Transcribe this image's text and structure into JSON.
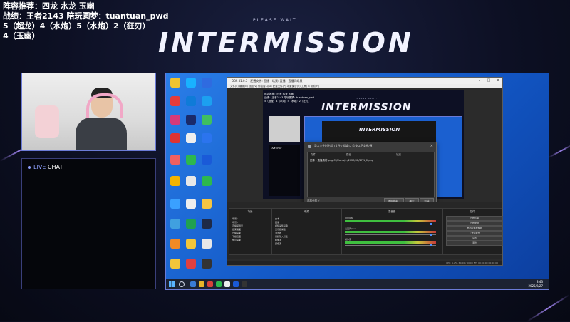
{
  "overlay": {
    "line1": "阵容推荐：四龙 水龙 玉幽",
    "line2": "战绩：王者2143 陪玩圆梦：tuantuan_pwd",
    "line3": "5（超龙）4（水炮）5（水炮）2（狂刃）",
    "line4": "4（玉幽）"
  },
  "title": {
    "subtitle": "PLEASE WAIT...",
    "main": "INTERMISSION"
  },
  "chat": {
    "live_word": "LIVE",
    "chat_word": "CHAT"
  },
  "obs": {
    "window_title": "OBS 31.0.3 - 配置文件: 直播 - 场景: 直播 - 直播间场景",
    "menu": "文件(F)  编辑(E)  视图(V)  停靠窗口(D)  配置文件(P)  场景集合(S)  工具(T)  帮助(H)",
    "preview_title": "INTERMISSION",
    "preview_subtitle": "PLEASE WAIT...",
    "nested_title": "INTERMISSION",
    "preview_chat": "LIVE CHAT",
    "dialog": {
      "title": "导入文件时出错 (文件 / 错误)，检查以下文件/源：",
      "col_file": "文件",
      "col_path": "路径",
      "col_status": "状态",
      "row": "图像 - 直播素材.png  C:/Users/.../2025/02/27/1_2.png",
      "left_btn": "选择全部  ✓",
      "btn_apply": "重新搜索...",
      "btn_ok": "确定",
      "btn_cancel": "取消"
    },
    "docks": {
      "scenes": "场景",
      "sources": "来源",
      "mixer": "混音器",
      "transitions": "转场",
      "controls": "控件",
      "scene_items": [
        "场景1",
        "场景2",
        "直播间场景",
        "结束画面",
        "开播画面",
        "下播画面",
        "休息画面"
      ],
      "source_items": [
        "文本",
        "图像",
        "视频采集设备",
        "显示器采集",
        "浏览器",
        "音频输入采集",
        "媒体源",
        "颜色源"
      ],
      "mixer_items": [
        "桌面音频",
        "麦克风/Aux",
        "媒体源"
      ],
      "control_buttons": [
        "开始直播",
        "开始录制",
        "启动虚拟摄像机",
        "工作室模式",
        "设置",
        "退出"
      ]
    },
    "status": "CPU: 5.2%, 60.00 / 60.00 FPS   00:00:00   00:00:00"
  },
  "taskbar": {
    "time": "8:43",
    "date": "2025/2/27"
  }
}
